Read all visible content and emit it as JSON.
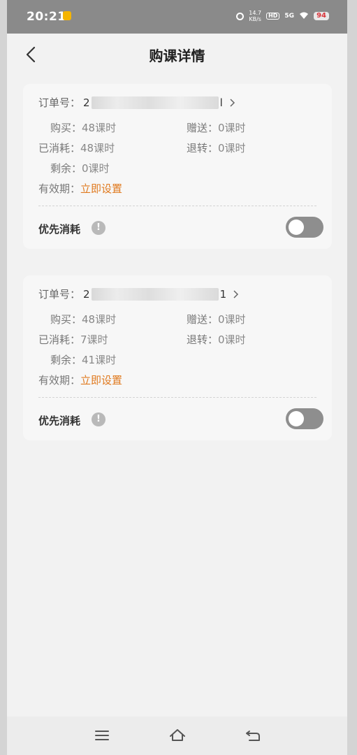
{
  "status_bar": {
    "time": "20:21",
    "speed_top": "14.7",
    "speed_bottom": "KB/s",
    "hd": "HD",
    "signal": "5G",
    "battery": "94"
  },
  "header": {
    "title": "购课详情"
  },
  "orders": [
    {
      "order_label": "订单号：",
      "order_prefix": "2",
      "order_suffix": "l",
      "purchase_label": "购买：",
      "purchase_value": "48课时",
      "gift_label": "赠送：",
      "gift_value": "0课时",
      "consumed_label": "已消耗：",
      "consumed_value": "48课时",
      "refund_label": "退转：",
      "refund_value": "0课时",
      "remaining_label": "剩余：",
      "remaining_value": "0课时",
      "validity_label": "有效期：",
      "validity_link": "立即设置",
      "priority_label": "优先消耗",
      "priority_toggle_on": false
    },
    {
      "order_label": "订单号：",
      "order_prefix": "2",
      "order_suffix": "1",
      "purchase_label": "购买：",
      "purchase_value": "48课时",
      "gift_label": "赠送：",
      "gift_value": "0课时",
      "consumed_label": "已消耗：",
      "consumed_value": "7课时",
      "refund_label": "退转：",
      "refund_value": "0课时",
      "remaining_label": "剩余：",
      "remaining_value": "41课时",
      "validity_label": "有效期：",
      "validity_link": "立即设置",
      "priority_label": "优先消耗",
      "priority_toggle_on": false
    }
  ],
  "colors": {
    "link": "#e07a1f",
    "toggle_off": "#8e8e8e",
    "status_bar": "#8a8a8a"
  },
  "icons": [
    "back-arrow-icon",
    "chevron-right-icon",
    "info-icon",
    "menu-icon",
    "home-icon",
    "back-nav-icon"
  ]
}
